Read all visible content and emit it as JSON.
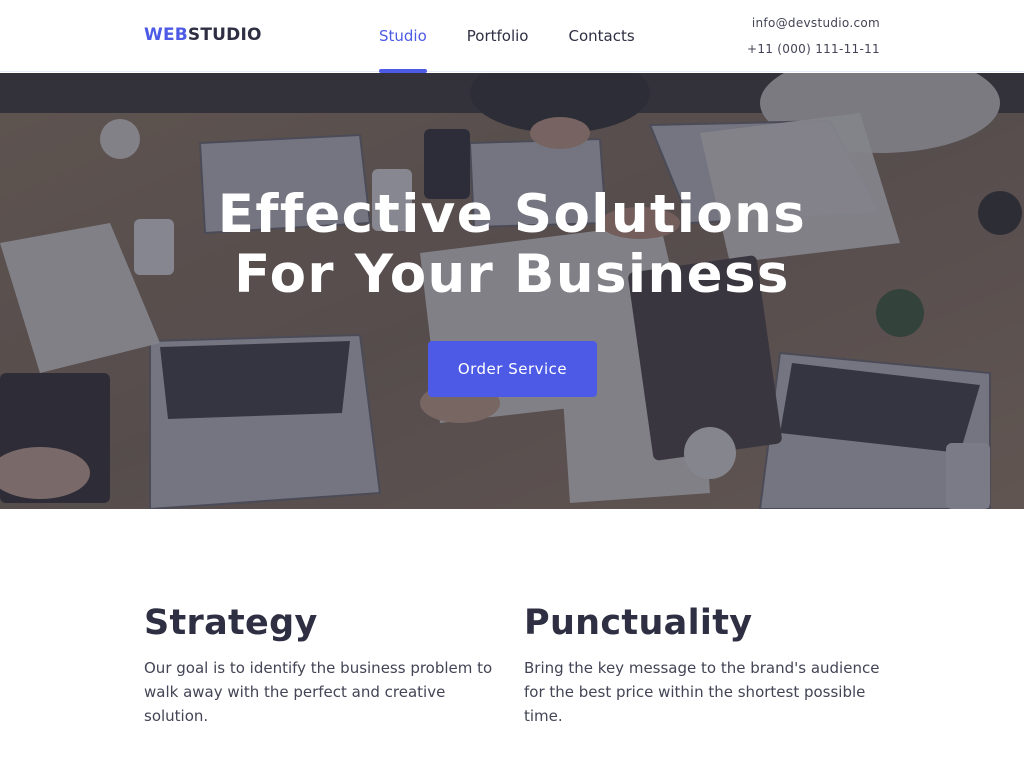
{
  "header": {
    "logo_accent": "WEB",
    "logo_main": "STUDIO",
    "nav": [
      {
        "label": "Studio",
        "active": true
      },
      {
        "label": "Portfolio",
        "active": false
      },
      {
        "label": "Contacts",
        "active": false
      }
    ],
    "email": "info@devstudio.com",
    "phone": "+11 (000) 111-11-11"
  },
  "hero": {
    "title_line1": "Effective Solutions",
    "title_line2": "For Your Business",
    "button_label": "Order Service"
  },
  "features": [
    {
      "title": "Strategy",
      "text": "Our goal is to identify the business problem to walk away with the perfect and creative solution."
    },
    {
      "title": "Punctuality",
      "text": "Bring the key message to the brand's audience for the best price within the shortest possible time."
    }
  ],
  "colors": {
    "accent": "#4d5ae5",
    "text_dark": "#2e2f42",
    "text_body": "#434455",
    "hero_overlay": "#2e2f42"
  }
}
